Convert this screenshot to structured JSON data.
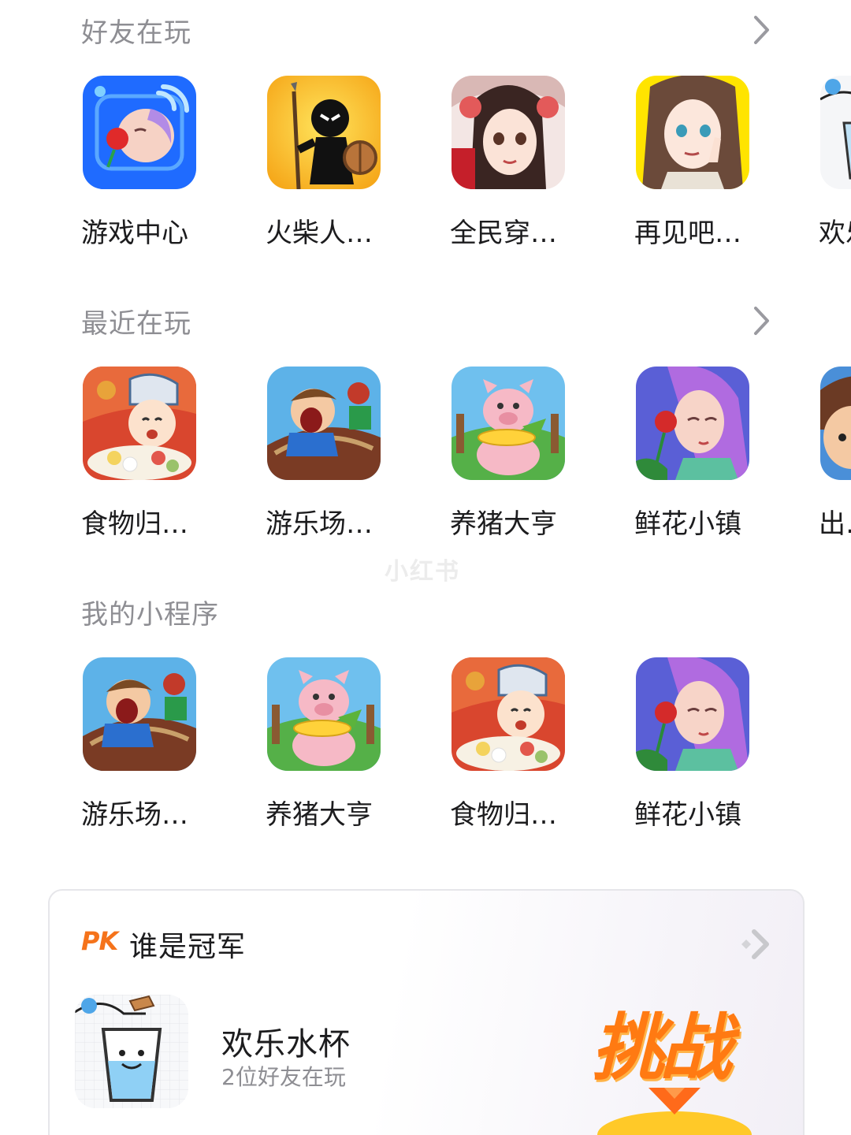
{
  "friends_playing": {
    "title": "好友在玩",
    "apps": [
      {
        "label": "游戏中心",
        "icon": "game-center-icon"
      },
      {
        "label": "火柴人…",
        "icon": "stickman-spear-icon"
      },
      {
        "label": "全民穿…",
        "icon": "anime-girl-roses-icon"
      },
      {
        "label": "再见吧…",
        "icon": "anime-girl-peace-icon"
      },
      {
        "label": "欢乐水杯",
        "icon": "water-cup-icon"
      }
    ]
  },
  "recently_played": {
    "title": "最近在玩",
    "apps": [
      {
        "label": "食物归…",
        "icon": "chef-boy-food-icon"
      },
      {
        "label": "游乐场…",
        "icon": "rollercoaster-boy-icon"
      },
      {
        "label": "养猪大亨",
        "icon": "pig-corn-icon"
      },
      {
        "label": "鲜花小镇",
        "icon": "girl-rose-icon"
      },
      {
        "label": "出…",
        "icon": "cartoon-boy-icon"
      }
    ]
  },
  "my_mini_programs": {
    "title": "我的小程序",
    "apps": [
      {
        "label": "游乐场…",
        "icon": "rollercoaster-boy-icon"
      },
      {
        "label": "养猪大亨",
        "icon": "pig-corn-icon"
      },
      {
        "label": "食物归…",
        "icon": "chef-boy-food-icon"
      },
      {
        "label": "鲜花小镇",
        "icon": "girl-rose-icon"
      }
    ]
  },
  "watermark": "小红书",
  "pk_card": {
    "badge": "PK",
    "title": "谁是冠军",
    "game_name": "欢乐水杯",
    "game_subtitle": "2位好友在玩",
    "challenge_label": "挑战",
    "icon": "water-cup-icon"
  },
  "colors": {
    "section_title": "#8e8e93",
    "label": "#1c1c1e",
    "accent_orange": "#ff7a12",
    "game_center_blue": "#1f6bff"
  }
}
